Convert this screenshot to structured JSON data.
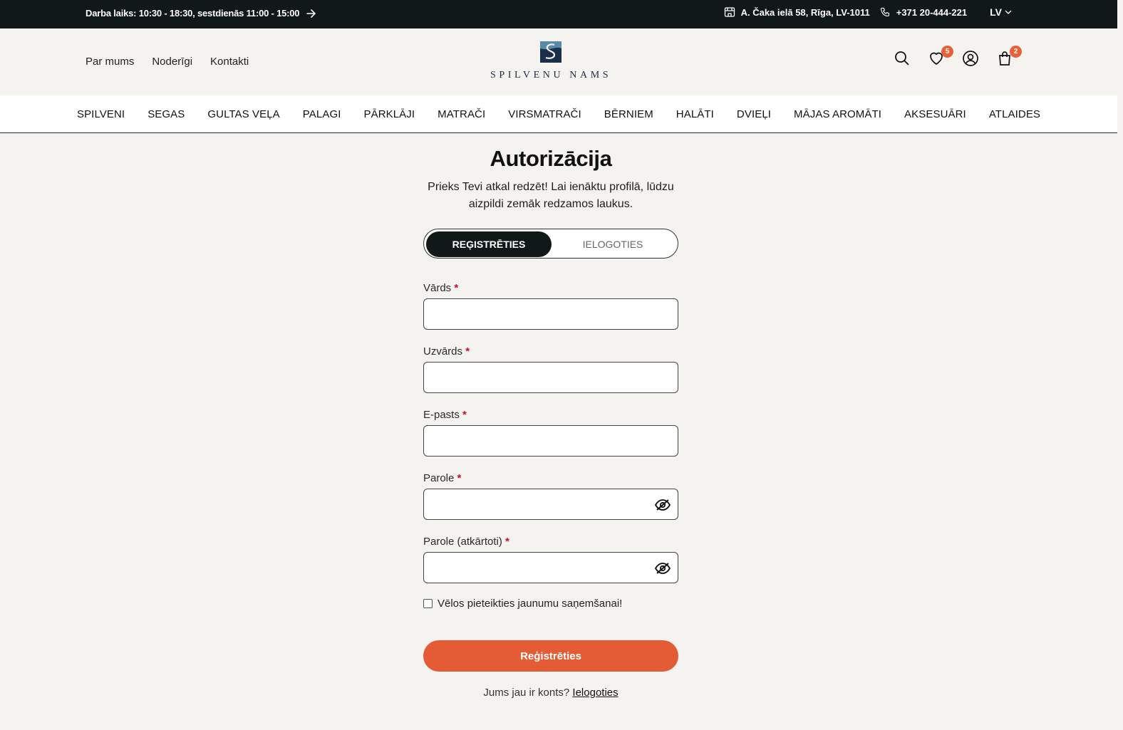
{
  "topbar": {
    "hours": "Darba laiks: 10:30 - 18:30, sestdienās 11:00 - 15:00",
    "address": "A. Čaka ielā 58, Rīga, LV-1011",
    "phone": "+371 20-444-221",
    "lang": "LV"
  },
  "header": {
    "links": [
      "Par mums",
      "Noderīgi",
      "Kontakti"
    ],
    "logo_text": "SPILVENU NAMS",
    "wishlist_count": "5",
    "cart_count": "2"
  },
  "nav": {
    "items": [
      "SPILVENI",
      "SEGAS",
      "GULTAS VEĻA",
      "PALAGI",
      "PĀRKLĀJI",
      "MATRAČI",
      "VIRSMATRAČI",
      "BĒRNIEM",
      "HALĀTI",
      "DVIEĻI",
      "MĀJAS AROMĀTI",
      "AKSESUĀRI",
      "ATLAIDES"
    ]
  },
  "form": {
    "title": "Autorizācija",
    "subtitle": "Prieks Tevi atkal redzēt! Lai ienāktu profilā, lūdzu aizpildi zemāk redzamos laukus.",
    "tab_active": "REĢISTRĒTIES",
    "tab_inactive": "IELOGOTIES",
    "fields": {
      "first_name": "Vārds",
      "last_name": "Uzvārds",
      "email": "E-pasts",
      "password": "Parole",
      "password_repeat": "Parole (atkārtoti)"
    },
    "required_mark": "*",
    "newsletter": "Vēlos pieteikties jaunumu saņemšanai!",
    "submit": "Reģistrēties",
    "have_account": "Jums jau ir konts?",
    "login_link": "Ielogoties"
  },
  "colors": {
    "accent": "#e45c35",
    "dark": "#111818",
    "background": "#f5f3f0"
  }
}
